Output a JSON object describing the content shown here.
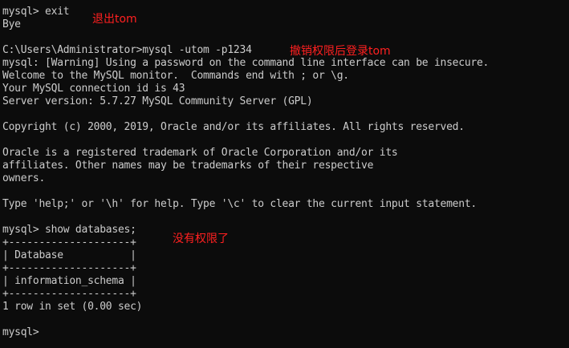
{
  "terminal": {
    "lines": [
      "mysql> exit",
      "Bye",
      "",
      "C:\\Users\\Administrator>mysql -utom -p1234",
      "mysql: [Warning] Using a password on the command line interface can be insecure.",
      "Welcome to the MySQL monitor.  Commands end with ; or \\g.",
      "Your MySQL connection id is 43",
      "Server version: 5.7.27 MySQL Community Server (GPL)",
      "",
      "Copyright (c) 2000, 2019, Oracle and/or its affiliates. All rights reserved.",
      "",
      "Oracle is a registered trademark of Oracle Corporation and/or its",
      "affiliates. Other names may be trademarks of their respective",
      "owners.",
      "",
      "Type 'help;' or '\\h' for help. Type '\\c' to clear the current input statement.",
      "",
      "mysql> show databases;",
      "+--------------------+",
      "| Database           |",
      "+--------------------+",
      "| information_schema |",
      "+--------------------+",
      "1 row in set (0.00 sec)",
      "",
      "mysql>"
    ]
  },
  "annotations": {
    "exit_note": "退出tom",
    "login_note": "撤销权限后登录tom",
    "no_privilege_note": "没有权限了"
  },
  "colors": {
    "background": "#0c0c0c",
    "text": "#cccccc",
    "annotation": "#ff2020"
  }
}
